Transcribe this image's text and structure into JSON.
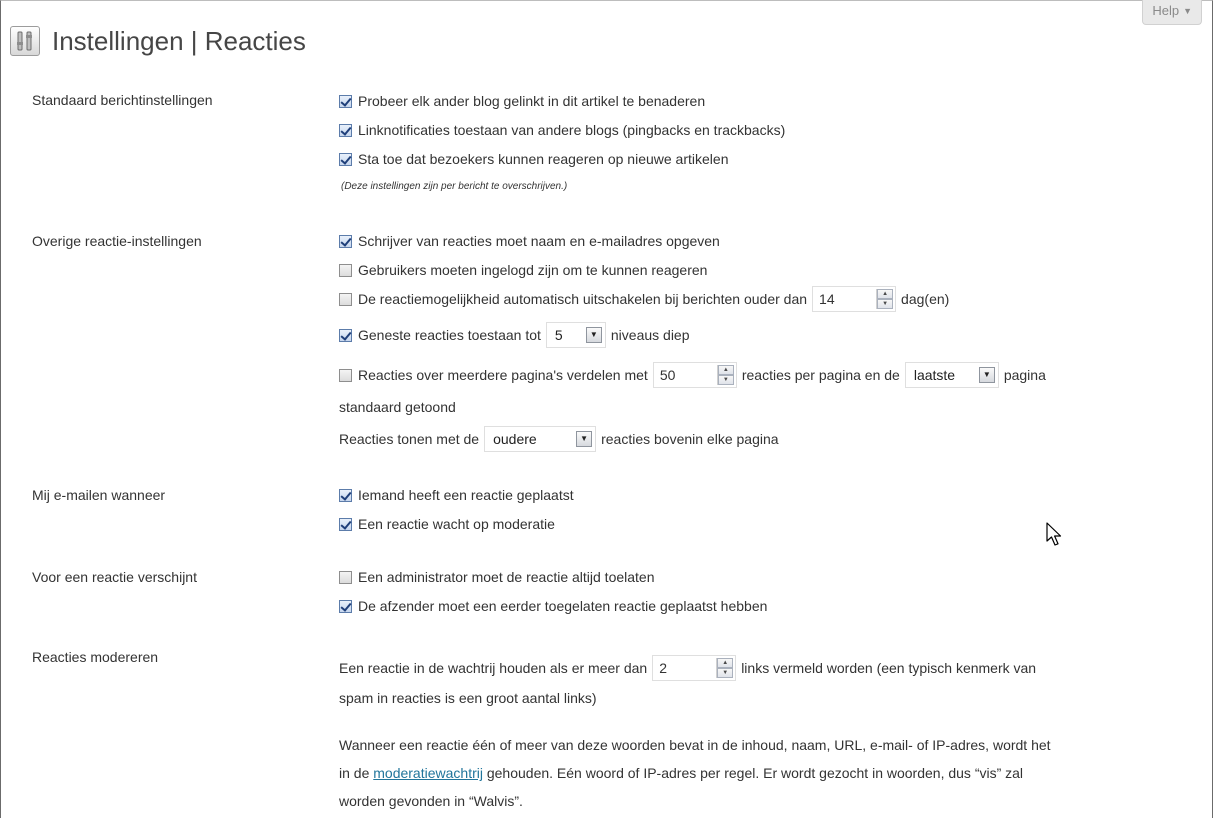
{
  "header": {
    "title": "Instellingen | Reacties",
    "help_label": "Help"
  },
  "sections": {
    "default_post": {
      "label": "Standaard berichtinstellingen",
      "options": [
        {
          "text": "Probeer elk ander blog gelinkt in dit artikel te benaderen",
          "checked": true
        },
        {
          "text": "Linknotificaties toestaan van andere blogs (pingbacks en trackbacks)",
          "checked": true
        },
        {
          "text": "Sta toe dat bezoekers kunnen reageren op nieuwe artikelen",
          "checked": true
        }
      ],
      "note": "(Deze instellingen zijn per bericht te overschrijven.)"
    },
    "other": {
      "label": "Overige reactie-instellingen",
      "opt1": "Schrijver van reacties moet naam en e-mailadres opgeven",
      "opt2": "Gebruikers moeten ingelogd zijn om te kunnen reageren",
      "opt3_before": "De reactiemogelijkheid automatisch uitschakelen bij berichten ouder dan",
      "opt3_value": "14",
      "opt3_after": "dag(en)",
      "opt4_before": "Geneste reacties toestaan tot",
      "opt4_value": "5",
      "opt4_after": "niveaus diep",
      "opt5_before": "Reacties over meerdere pagina's verdelen met",
      "opt5_value": "50",
      "opt5_middle": "reacties per pagina en de",
      "opt5_select": "laatste",
      "opt5_after": "pagina",
      "opt5_wrap": "standaard getoond",
      "order_before": "Reacties tonen met de",
      "order_select": "oudere",
      "order_after": "reacties bovenin elke pagina",
      "checked": [
        true,
        false,
        false,
        true,
        false
      ]
    },
    "email": {
      "label": "Mij e-mailen wanneer",
      "opt1": "Iemand heeft een reactie geplaatst",
      "opt2": "Een reactie wacht op moderatie",
      "checked": [
        true,
        true
      ]
    },
    "before_appears": {
      "label": "Voor een reactie verschijnt",
      "opt1": "Een administrator moet de reactie altijd toelaten",
      "opt2": "De afzender moet een eerder toegelaten reactie geplaatst hebben",
      "checked": [
        false,
        true
      ]
    },
    "moderation": {
      "label": "Reacties modereren",
      "hold_before": "Een reactie in de wachtrij houden als er meer dan",
      "hold_value": "2",
      "hold_after": "links vermeld worden (een typisch kenmerk van",
      "hold_wrap": "spam in reacties is een groot aantal links)",
      "desc_before": "Wanneer een reactie één of meer van deze woorden bevat in de inhoud, naam, URL, e-mail- of IP-adres, wordt het",
      "desc_in_de": "in de",
      "desc_link": "moderatiewachtrij",
      "desc_after": "gehouden. Eén woord of IP-adres per regel. Er wordt gezocht in woorden, dus “vis” zal",
      "desc_last": "worden gevonden in “Walvis”."
    }
  }
}
